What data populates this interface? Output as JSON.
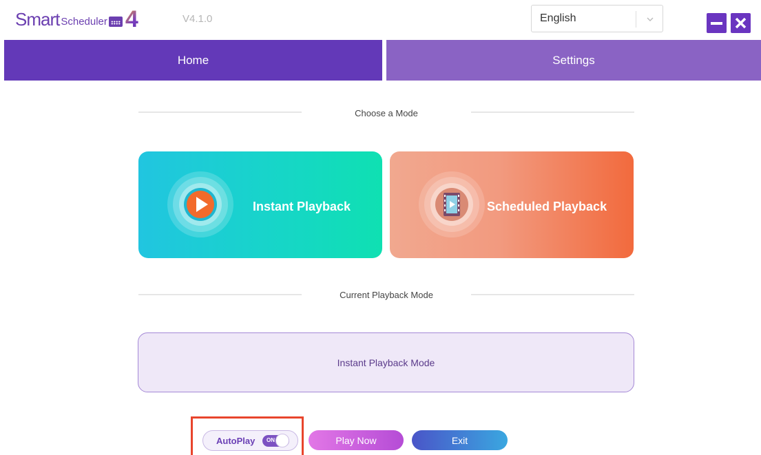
{
  "app": {
    "logo_text_smart": "Smart",
    "logo_text_scheduler": "Scheduler",
    "logo_text_version_number": "4",
    "version": "V4.1.0"
  },
  "language_select": {
    "value": "English",
    "icon": "chevron-down-icon"
  },
  "window_controls": {
    "minimize_icon": "minimize-icon",
    "close_icon": "close-icon",
    "color": "#6a35c0"
  },
  "tabs": [
    {
      "label": "Home",
      "active": true
    },
    {
      "label": "Settings",
      "active": false
    }
  ],
  "choose_mode": {
    "label": "Choose a Mode",
    "cards": [
      {
        "title": "Instant Playback",
        "icon": "play-icon"
      },
      {
        "title": "Scheduled Playback",
        "icon": "film-icon"
      }
    ]
  },
  "current_mode": {
    "label": "Current Playback Mode",
    "value": "Instant Playback Mode"
  },
  "controls": {
    "autoplay_label": "AutoPlay",
    "autoplay_toggle_text": "ON",
    "autoplay_on": true,
    "play_now_label": "Play Now",
    "exit_label": "Exit"
  },
  "colors": {
    "primary": "#6339b8",
    "tab_inactive": "#8a63c4",
    "highlight": "#e8452c"
  }
}
